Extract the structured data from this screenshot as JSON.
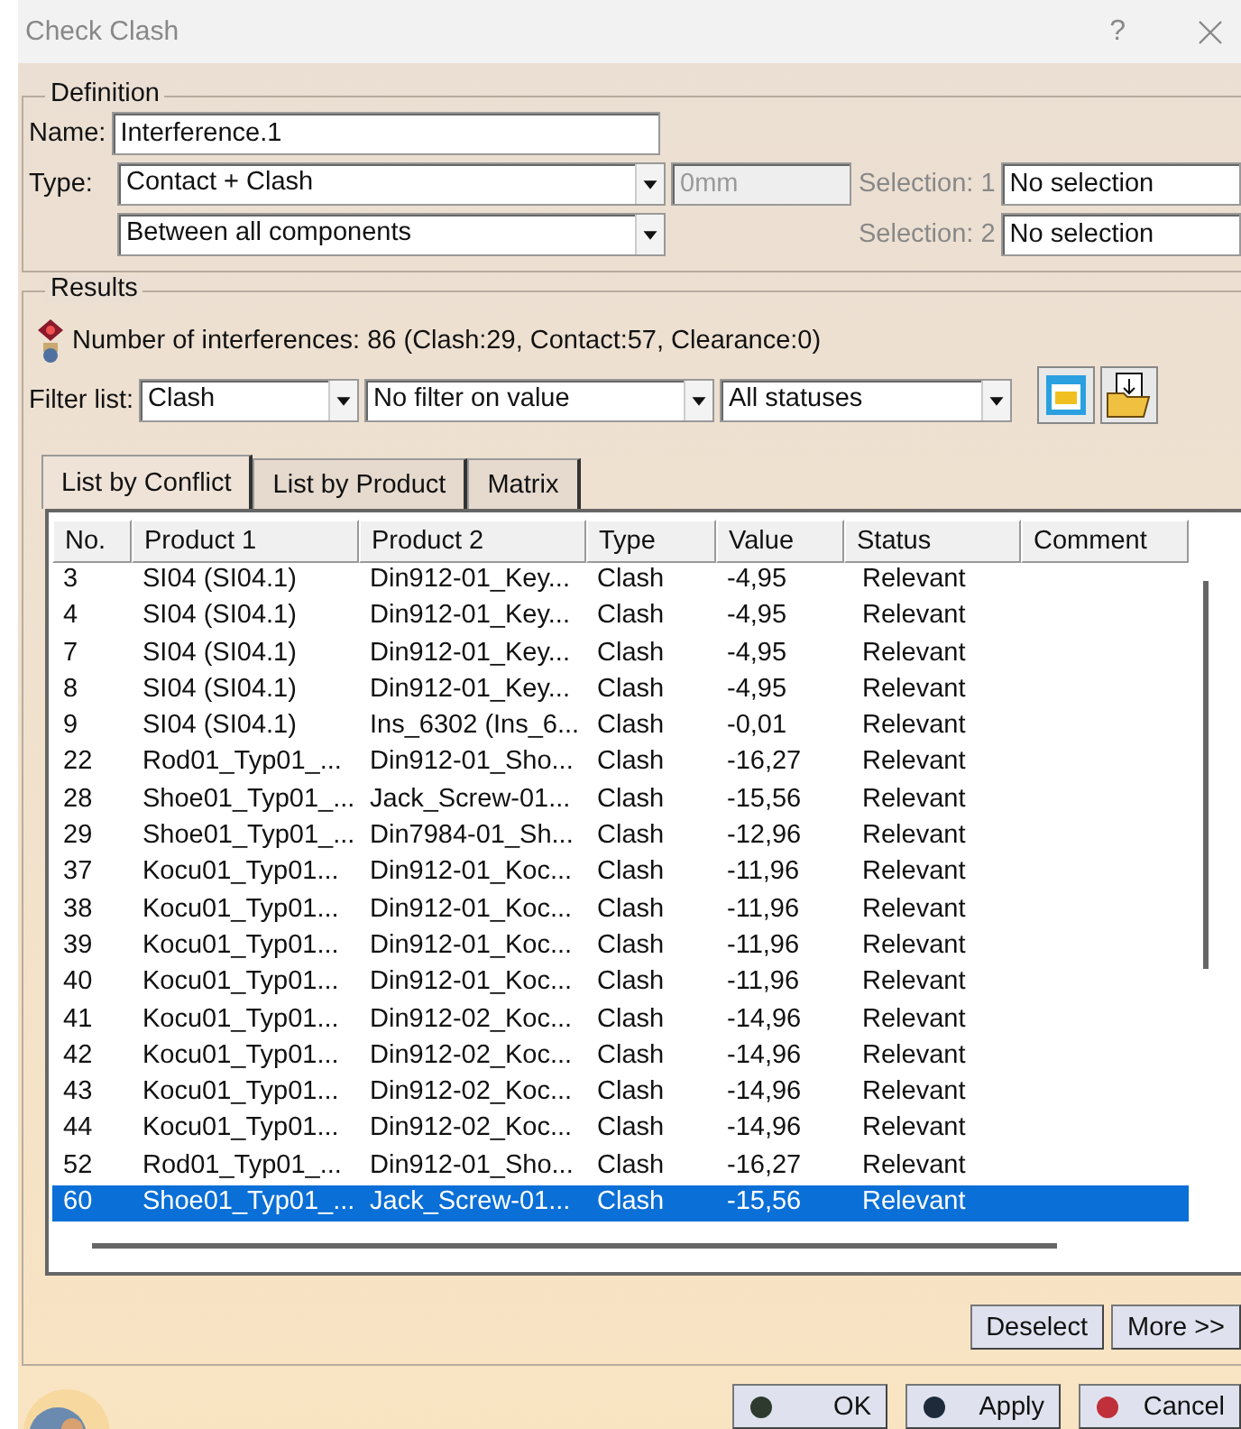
{
  "window": {
    "title": "Check Clash",
    "help": "?"
  },
  "definition": {
    "legend": "Definition",
    "name_label": "Name:",
    "name_value": "Interference.1",
    "type_label": "Type:",
    "type_value": "Contact + Clash",
    "scope_value": "Between all components",
    "clearance_value": "0mm",
    "clearance_disabled": true,
    "selections": [
      {
        "label": "Selection: 1",
        "value": "No selection"
      },
      {
        "label": "Selection: 2",
        "value": "No selection"
      }
    ]
  },
  "results": {
    "legend": "Results",
    "summary": "Number of interferences: 86 (Clash:29, Contact:57, Clearance:0)",
    "filter_label": "Filter list:",
    "filters": [
      "Clash",
      "No filter on value",
      "All statuses"
    ],
    "tabs": [
      {
        "label": "List by Conflict",
        "selected": true
      },
      {
        "label": "List by Product",
        "selected": false
      },
      {
        "label": "Matrix",
        "selected": false
      }
    ],
    "columns": [
      "No.",
      "Product 1",
      "Product 2",
      "Type",
      "Value",
      "Status",
      "Comment"
    ],
    "rows": [
      {
        "cells": [
          "3",
          "SI04 (SI04.1)",
          "Din912-01_Key...",
          "Clash",
          "-4,95",
          "Relevant"
        ],
        "selected": false
      },
      {
        "cells": [
          "4",
          "SI04 (SI04.1)",
          "Din912-01_Key...",
          "Clash",
          "-4,95",
          "Relevant"
        ],
        "selected": false
      },
      {
        "cells": [
          "7",
          "SI04 (SI04.1)",
          "Din912-01_Key...",
          "Clash",
          "-4,95",
          "Relevant"
        ],
        "selected": false
      },
      {
        "cells": [
          "8",
          "SI04 (SI04.1)",
          "Din912-01_Key...",
          "Clash",
          "-4,95",
          "Relevant"
        ],
        "selected": false
      },
      {
        "cells": [
          "9",
          "SI04 (SI04.1)",
          "Ins_6302 (Ins_6...",
          "Clash",
          "-0,01",
          "Relevant"
        ],
        "selected": false
      },
      {
        "cells": [
          "22",
          "Rod01_Typ01_...",
          "Din912-01_Sho...",
          "Clash",
          "-16,27",
          "Relevant"
        ],
        "selected": false
      },
      {
        "cells": [
          "28",
          "Shoe01_Typ01_...",
          "Jack_Screw-01...",
          "Clash",
          "-15,56",
          "Relevant"
        ],
        "selected": false
      },
      {
        "cells": [
          "29",
          "Shoe01_Typ01_...",
          "Din7984-01_Sh...",
          "Clash",
          "-12,96",
          "Relevant"
        ],
        "selected": false
      },
      {
        "cells": [
          "37",
          "Kocu01_Typ01...",
          "Din912-01_Koc...",
          "Clash",
          "-11,96",
          "Relevant"
        ],
        "selected": false
      },
      {
        "cells": [
          "38",
          "Kocu01_Typ01...",
          "Din912-01_Koc...",
          "Clash",
          "-11,96",
          "Relevant"
        ],
        "selected": false
      },
      {
        "cells": [
          "39",
          "Kocu01_Typ01...",
          "Din912-01_Koc...",
          "Clash",
          "-11,96",
          "Relevant"
        ],
        "selected": false
      },
      {
        "cells": [
          "40",
          "Kocu01_Typ01...",
          "Din912-01_Koc...",
          "Clash",
          "-11,96",
          "Relevant"
        ],
        "selected": false
      },
      {
        "cells": [
          "41",
          "Kocu01_Typ01...",
          "Din912-02_Koc...",
          "Clash",
          "-14,96",
          "Relevant"
        ],
        "selected": false
      },
      {
        "cells": [
          "42",
          "Kocu01_Typ01...",
          "Din912-02_Koc...",
          "Clash",
          "-14,96",
          "Relevant"
        ],
        "selected": false
      },
      {
        "cells": [
          "43",
          "Kocu01_Typ01...",
          "Din912-02_Koc...",
          "Clash",
          "-14,96",
          "Relevant"
        ],
        "selected": false
      },
      {
        "cells": [
          "44",
          "Kocu01_Typ01...",
          "Din912-02_Koc...",
          "Clash",
          "-14,96",
          "Relevant"
        ],
        "selected": false
      },
      {
        "cells": [
          "52",
          "Rod01_Typ01_...",
          "Din912-01_Sho...",
          "Clash",
          "-16,27",
          "Relevant"
        ],
        "selected": false
      },
      {
        "cells": [
          "60",
          "Shoe01_Typ01_...",
          "Jack_Screw-01...",
          "Clash",
          "-15,56",
          "Relevant"
        ],
        "selected": true
      }
    ],
    "list_buttons": [
      "Deselect",
      "More >>"
    ]
  },
  "footer_buttons": [
    {
      "label": "OK",
      "color": "#2e3a2e"
    },
    {
      "label": "Apply",
      "color": "#1e2a3a"
    },
    {
      "label": "Cancel",
      "color": "#c0303a"
    }
  ]
}
